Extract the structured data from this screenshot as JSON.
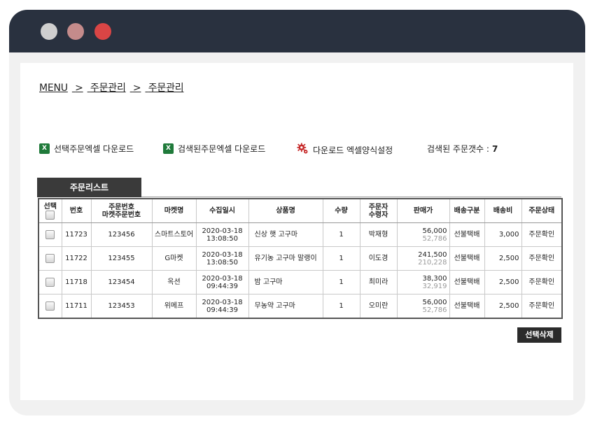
{
  "breadcrumb": {
    "root": "MENU",
    "sep1": ">",
    "level1": "주문관리",
    "sep2": ">",
    "level2": "주문관리"
  },
  "toolbar": {
    "download_selected": "선택주문엑셀 다운로드",
    "download_searched": "검색된주문엑셀 다운로드",
    "download_settings": "다운로드 엑셀양식설정",
    "count_label": "검색된 주문갯수 :",
    "count_value": "7",
    "excel_icon_glyph": "X"
  },
  "tab": {
    "label": "주문리스트"
  },
  "table": {
    "headers": {
      "select": "선택",
      "no": "번호",
      "order_no_1": "주문번호",
      "order_no_2": "마켓주문번호",
      "market": "마켓명",
      "collected": "수집일시",
      "product": "상품명",
      "qty": "수량",
      "orderer_1": "주문자",
      "orderer_2": "수령자",
      "price": "판매가",
      "ship_type": "배송구분",
      "ship_fee": "배송비",
      "status": "주문상태"
    },
    "rows": [
      {
        "no": "11723",
        "order_no": "123456",
        "market": "스마트스토어",
        "date": "2020-03-18",
        "time": "13:08:50",
        "product": "신상 햇 고구마",
        "qty": "1",
        "person": "박재형",
        "price": "56,000",
        "price_sub": "52,786",
        "ship_type": "선불택배",
        "ship_fee": "3,000",
        "status": "주문확인"
      },
      {
        "no": "11722",
        "order_no": "123455",
        "market": "G마켓",
        "date": "2020-03-18",
        "time": "13:08:50",
        "product": "유기농 고구마 말랭이",
        "qty": "1",
        "person": "이도경",
        "price": "241,500",
        "price_sub": "210,228",
        "ship_type": "선불택배",
        "ship_fee": "2,500",
        "status": "주문확인"
      },
      {
        "no": "11718",
        "order_no": "123454",
        "market": "옥션",
        "date": "2020-03-18",
        "time": "09:44:39",
        "product": "밤 고구마",
        "qty": "1",
        "person": "최미라",
        "price": "38,300",
        "price_sub": "32,919",
        "ship_type": "선불택배",
        "ship_fee": "2,500",
        "status": "주문확인"
      },
      {
        "no": "11711",
        "order_no": "123453",
        "market": "위메프",
        "date": "2020-03-18",
        "time": "09:44:39",
        "product": "무농약 고구마",
        "qty": "1",
        "person": "오미란",
        "price": "56,000",
        "price_sub": "52,786",
        "ship_type": "선불택배",
        "ship_fee": "2,500",
        "status": "주문확인"
      }
    ]
  },
  "actions": {
    "delete_selected": "선택삭제"
  },
  "colors": {
    "titlebar": "#29313f",
    "dot_gray": "#cfcfcf",
    "dot_rose": "#c48b8b",
    "dot_red": "#d94545",
    "excel_green": "#1f7a3a",
    "gear_red": "#c62828",
    "tab_dark": "#3a3a3a"
  }
}
